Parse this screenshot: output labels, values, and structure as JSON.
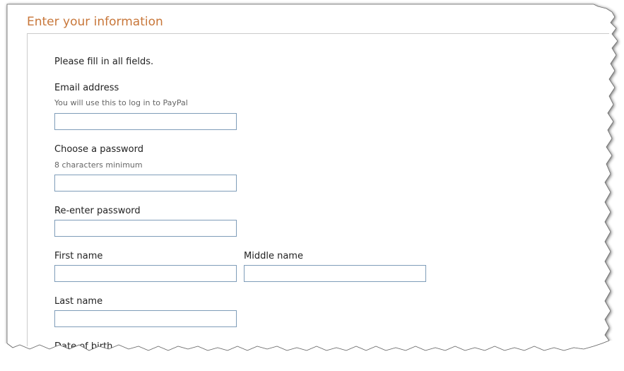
{
  "section": {
    "title": "Enter your information",
    "instructions": "Please fill in all fields."
  },
  "form": {
    "email": {
      "label": "Email address",
      "hint": "You will use this to log in to PayPal",
      "value": ""
    },
    "password": {
      "label": "Choose a password",
      "hint": "8 characters minimum",
      "value": ""
    },
    "confirm_password": {
      "label": "Re-enter password",
      "value": ""
    },
    "first_name": {
      "label": "First name",
      "value": ""
    },
    "middle_name": {
      "label": "Middle name",
      "value": ""
    },
    "last_name": {
      "label": "Last name",
      "value": ""
    },
    "date_of_birth": {
      "label": "Date of birth"
    }
  },
  "colors": {
    "title": "#c8773a",
    "field_border": "#7f9db9",
    "panel_border": "#cccccc"
  }
}
